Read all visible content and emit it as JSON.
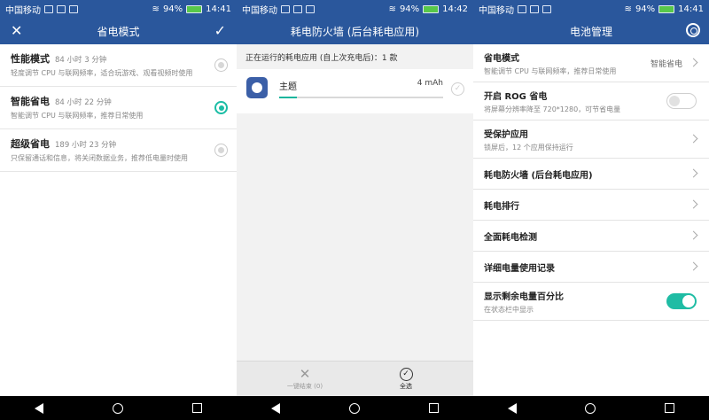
{
  "status": [
    {
      "carrier": "中国移动",
      "battery": "94%",
      "time": "14:41"
    },
    {
      "carrier": "中国移动",
      "battery": "94%",
      "time": "14:42"
    },
    {
      "carrier": "中国移动",
      "battery": "94%",
      "time": "14:41"
    }
  ],
  "power_mode": {
    "title": "省电模式",
    "modes": [
      {
        "name": "性能模式",
        "duration": "84 小时 3 分钟",
        "desc": "轻度调节 CPU 与联网频率，适合玩游戏、观看视频时使用",
        "selected": false
      },
      {
        "name": "智能省电",
        "duration": "84 小时 22 分钟",
        "desc": "智能调节 CPU 与联网频率，推荐日常使用",
        "selected": true
      },
      {
        "name": "超级省电",
        "duration": "189 小时 23 分钟",
        "desc": "只保留通话和信息，将关闭数据业务，推荐低电量时使用",
        "selected": false
      }
    ]
  },
  "firewall": {
    "title": "耗电防火墙 (后台耗电应用)",
    "subtitle": "正在运行的耗电应用 (自上次充电后)：1 款",
    "apps": [
      {
        "name": "主题",
        "usage": "4 mAh",
        "usage_fraction": 0.11
      }
    ],
    "bottom": {
      "end_all": "一键结束 (0)",
      "select_all": "全选"
    }
  },
  "battery_mgmt": {
    "title": "电池管理",
    "rows": [
      {
        "title": "省电模式",
        "sub": "智能调节 CPU 与联网频率，推荐日常使用",
        "value": "智能省电"
      },
      {
        "title": "开启 ROG 省电",
        "sub": "将屏幕分辨率降至 720*1280，可节省电量"
      },
      {
        "title": "受保护应用",
        "sub": "锁屏后，12 个应用保持运行"
      },
      {
        "title": "耗电防火墙 (后台耗电应用)"
      },
      {
        "title": "耗电排行"
      },
      {
        "title": "全面耗电检测"
      },
      {
        "title": "详细电量使用记录"
      },
      {
        "title": "显示剩余电量百分比",
        "sub": "在状态栏中显示"
      }
    ],
    "rog_enabled": false,
    "show_percent_enabled": true
  },
  "colors": {
    "header": "#2a579c",
    "accent": "#1bbda5"
  }
}
